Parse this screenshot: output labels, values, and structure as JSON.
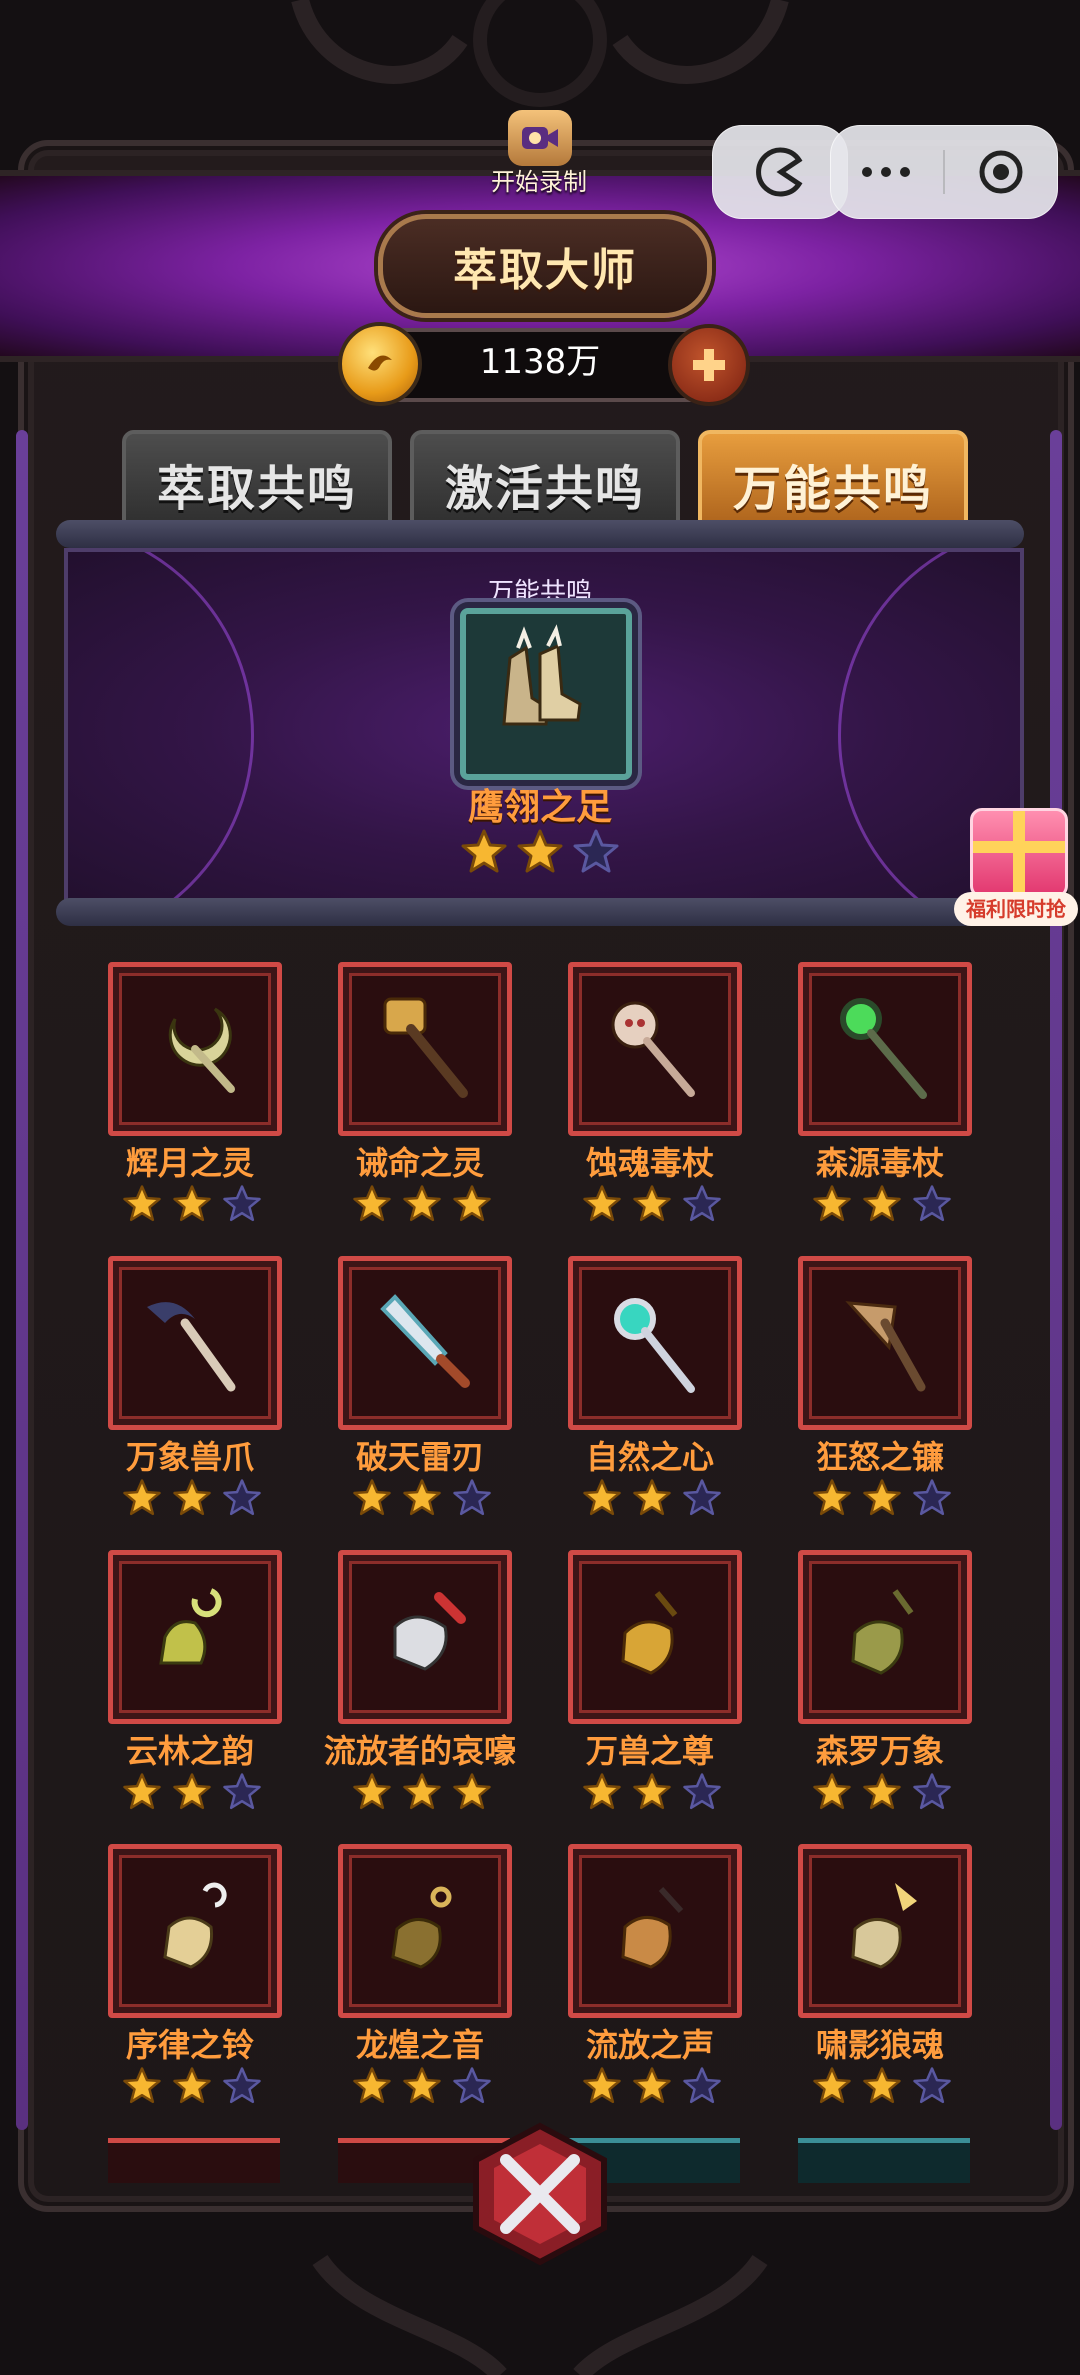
{
  "header": {
    "title": "萃取大师",
    "record_label": "开始录制",
    "currency_value": "1138万"
  },
  "tabs": [
    {
      "label": "萃取共鸣",
      "active": false
    },
    {
      "label": "激活共鸣",
      "active": false
    },
    {
      "label": "万能共鸣",
      "active": true
    }
  ],
  "featured": {
    "label": "万能共鸣",
    "name": "鹰翎之足",
    "stars": 2,
    "max_stars": 3
  },
  "promo": {
    "label": "福利限时抢"
  },
  "items": [
    {
      "name": "辉月之灵",
      "stars": 2,
      "icon": "crescent-staff-icon"
    },
    {
      "name": "诫命之灵",
      "stars": 3,
      "icon": "golden-mace-icon"
    },
    {
      "name": "蚀魂毒杖",
      "stars": 2,
      "icon": "skull-staff-icon"
    },
    {
      "name": "森源毒杖",
      "stars": 2,
      "icon": "green-orb-staff-icon"
    },
    {
      "name": "万象兽爪",
      "stars": 2,
      "icon": "claw-staff-icon"
    },
    {
      "name": "破天雷刃",
      "stars": 2,
      "icon": "serrated-blade-icon"
    },
    {
      "name": "自然之心",
      "stars": 2,
      "icon": "nature-orb-staff-icon"
    },
    {
      "name": "狂怒之镰",
      "stars": 2,
      "icon": "war-axe-icon"
    },
    {
      "name": "云林之韵",
      "stars": 2,
      "icon": "moon-bell-icon"
    },
    {
      "name": "流放者的哀嚎",
      "stars": 3,
      "icon": "silver-bell-icon"
    },
    {
      "name": "万兽之尊",
      "stars": 2,
      "icon": "golden-bell-icon"
    },
    {
      "name": "森罗万象",
      "stars": 2,
      "icon": "olive-bell-icon"
    },
    {
      "name": "序律之铃",
      "stars": 2,
      "icon": "hook-bell-icon"
    },
    {
      "name": "龙煌之音",
      "stars": 2,
      "icon": "ring-bell-icon"
    },
    {
      "name": "流放之声",
      "stars": 2,
      "icon": "copper-bell-icon"
    },
    {
      "name": "啸影狼魂",
      "stars": 2,
      "icon": "spike-bell-icon"
    }
  ],
  "colors": {
    "accent": "#ff9c3d",
    "active_tab": "#e79d3e",
    "slot_border": "#d04a46",
    "star_filled": "#f7b731",
    "star_empty": "#2b2754"
  }
}
